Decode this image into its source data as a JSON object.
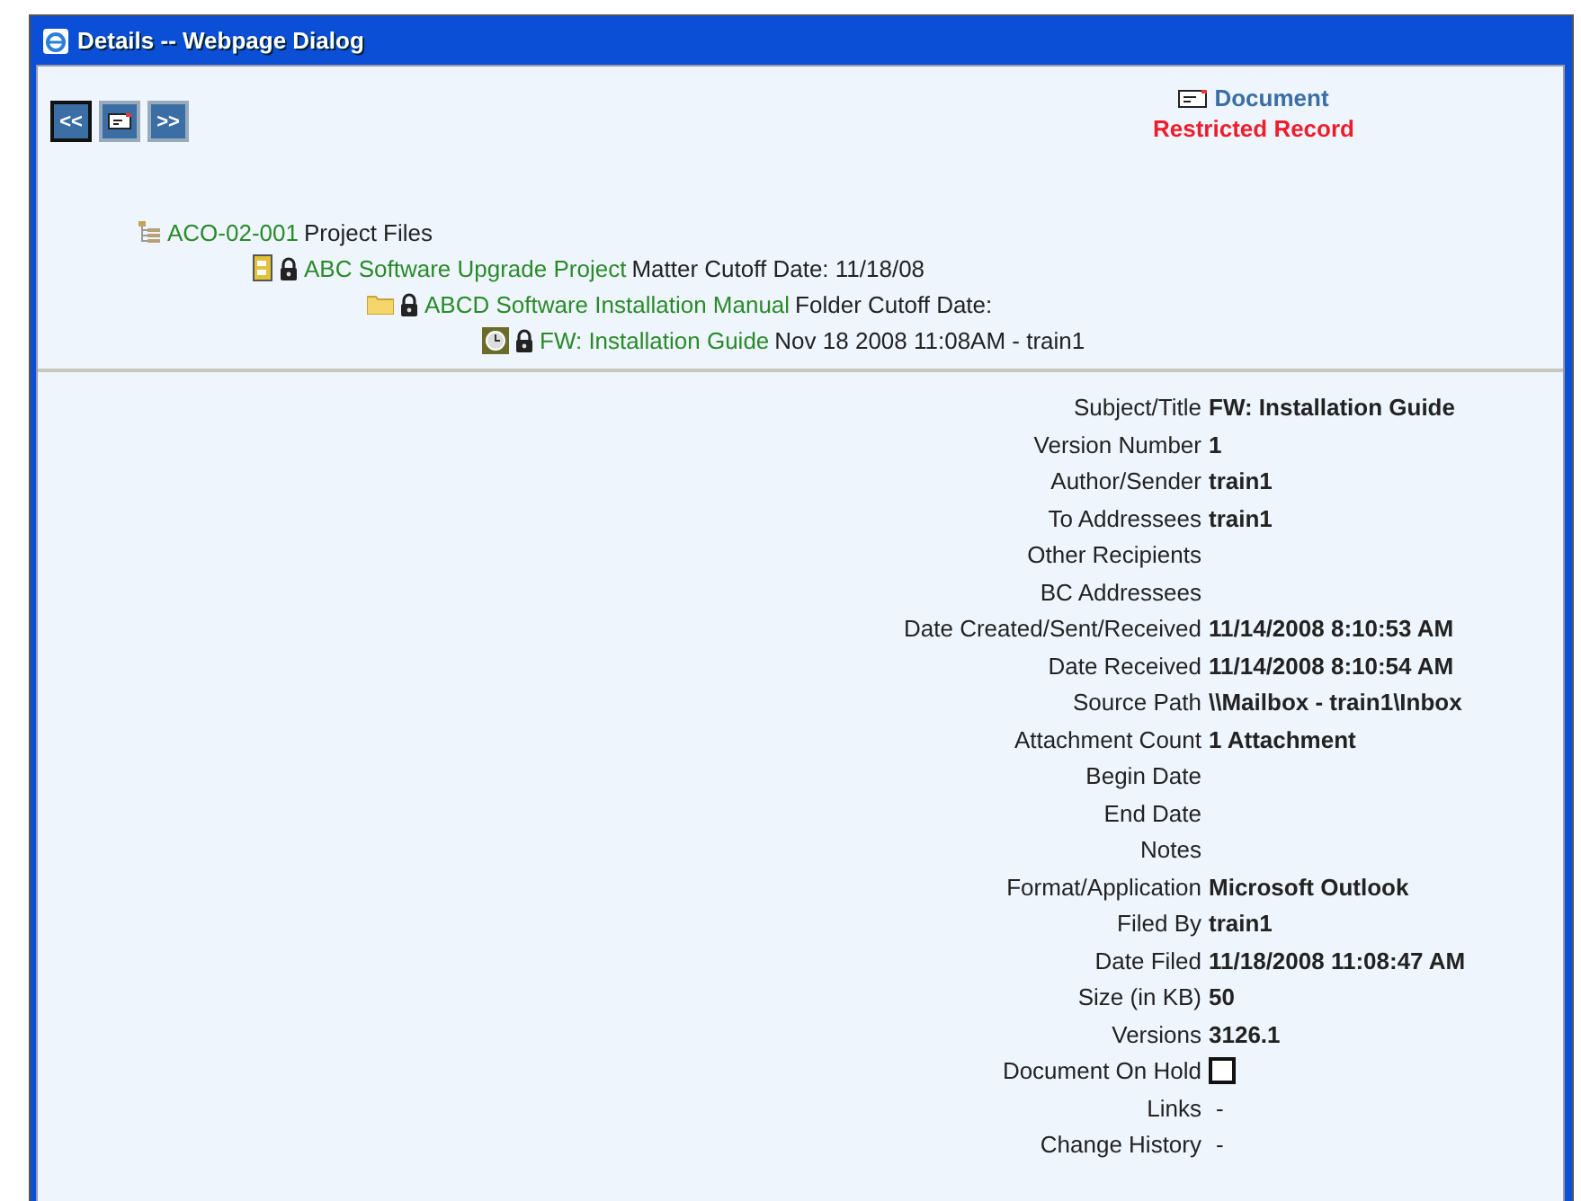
{
  "window": {
    "title": "Details -- Webpage Dialog"
  },
  "nav": {
    "prev": "<<",
    "next": ">>"
  },
  "header": {
    "type_label": "Document",
    "restriction": "Restricted Record"
  },
  "tree": [
    {
      "kind": "project",
      "locked": false,
      "name": "ACO-02-001",
      "detail": "Project Files",
      "children": [
        {
          "kind": "matter",
          "locked": true,
          "name": "ABC Software Upgrade Project",
          "detail": "Matter Cutoff Date: 11/18/08",
          "children": [
            {
              "kind": "folder",
              "locked": true,
              "name": "ABCD Software Installation Manual",
              "detail": "Folder Cutoff Date:",
              "children": [
                {
                  "kind": "email",
                  "locked": true,
                  "name": "FW: Installation Guide",
                  "detail": "Nov 18 2008 11:08AM - train1"
                }
              ]
            }
          ]
        }
      ]
    }
  ],
  "properties": [
    {
      "kind": "value",
      "label": "Subject/Title",
      "value": "FW: Installation Guide"
    },
    {
      "kind": "value",
      "label": "Version Number",
      "value": "1"
    },
    {
      "kind": "value",
      "label": "Author/Sender",
      "value": "train1"
    },
    {
      "kind": "value",
      "label": "To Addressees",
      "value": "train1"
    },
    {
      "kind": "value",
      "label": "Other Recipients"
    },
    {
      "kind": "value",
      "label": "BC Addressees"
    },
    {
      "kind": "value",
      "label": "Date Created/Sent/Received",
      "value": "11/14/2008 8:10:53 AM"
    },
    {
      "kind": "value",
      "label": "Date Received",
      "value": "11/14/2008 8:10:54 AM"
    },
    {
      "kind": "value",
      "label": "Source Path",
      "value": "\\\\Mailbox - train1\\Inbox"
    },
    {
      "kind": "value",
      "label": "Attachment Count",
      "value": "1 Attachment"
    },
    {
      "kind": "value",
      "label": "Begin Date"
    },
    {
      "kind": "value",
      "label": "End Date"
    },
    {
      "kind": "value",
      "label": "Notes"
    },
    {
      "kind": "value",
      "label": "Format/Application",
      "value": "Microsoft Outlook"
    },
    {
      "kind": "value",
      "label": "Filed By",
      "value": "train1"
    },
    {
      "kind": "value",
      "label": "Date Filed",
      "value": "11/18/2008 11:08:47 AM"
    },
    {
      "kind": "value",
      "label": "Size (in KB)",
      "value": "50"
    },
    {
      "kind": "value",
      "label": "Versions",
      "value": "3126.1"
    },
    {
      "kind": "checkbox",
      "label": "Document On Hold",
      "checked": false
    },
    {
      "kind": "plain",
      "label": "Links",
      "placeholder_mark": "-"
    },
    {
      "kind": "plain",
      "label": "Change History",
      "placeholder_mark": "-"
    }
  ]
}
